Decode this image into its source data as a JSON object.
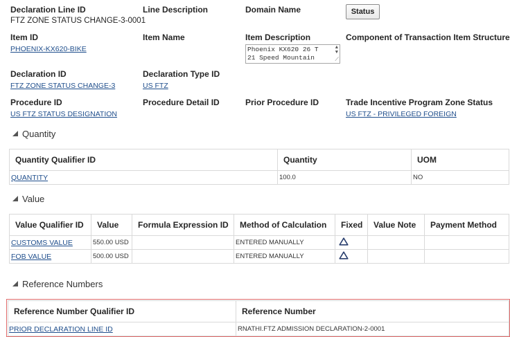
{
  "header": {
    "declaration_line_id": {
      "label": "Declaration Line ID",
      "value": "FTZ ZONE STATUS CHANGE-3-0001"
    },
    "line_description": {
      "label": "Line Description"
    },
    "domain_name": {
      "label": "Domain Name"
    },
    "status_button": "Status",
    "item_id": {
      "label": "Item ID",
      "value": "PHOENIX-KX620-BIKE"
    },
    "item_name": {
      "label": "Item Name"
    },
    "item_description": {
      "label": "Item Description",
      "line1": "Phoenix KX620 26 T",
      "line2": "21 Speed Mountain"
    },
    "component": {
      "label": "Component of Transaction Item Structure"
    },
    "declaration_id": {
      "label": "Declaration ID",
      "value": "FTZ ZONE STATUS CHANGE-3"
    },
    "declaration_type_id": {
      "label": "Declaration Type ID",
      "value": "US FTZ"
    },
    "procedure_id": {
      "label": "Procedure ID",
      "value": "US FTZ STATUS DESIGNATION"
    },
    "procedure_detail_id": {
      "label": "Procedure Detail ID"
    },
    "prior_procedure_id": {
      "label": "Prior Procedure ID"
    },
    "trade_incentive": {
      "label": "Trade Incentive Program Zone Status",
      "value": "US FTZ - PRIVILEGED FOREIGN"
    }
  },
  "quantity": {
    "title": "Quantity",
    "columns": [
      "Quantity Qualifier ID",
      "Quantity",
      "UOM"
    ],
    "rows": [
      [
        "QUANTITY",
        "100.0",
        "NO"
      ]
    ]
  },
  "value": {
    "title": "Value",
    "columns": [
      "Value Qualifier ID",
      "Value",
      "Formula Expression ID",
      "Method of Calculation",
      "Fixed",
      "Value Note",
      "Payment Method"
    ],
    "rows": [
      [
        "CUSTOMS VALUE",
        "550.00 USD",
        "",
        "ENTERED MANUALLY",
        "triangle-icon",
        "",
        ""
      ],
      [
        "FOB VALUE",
        "500.00 USD",
        "",
        "ENTERED MANUALLY",
        "triangle-icon",
        "",
        ""
      ]
    ]
  },
  "reference_numbers": {
    "title": "Reference Numbers",
    "columns": [
      "Reference Number Qualifier ID",
      "Reference Number"
    ],
    "rows": [
      [
        "PRIOR DECLARATION LINE ID",
        "RNATHI.FTZ ADMISSION DECLARATION-2-0001"
      ]
    ]
  },
  "colors": {
    "link": "#1f4e8c",
    "highlight_border": "#e06b6b",
    "grid": "#d9d9d9"
  }
}
